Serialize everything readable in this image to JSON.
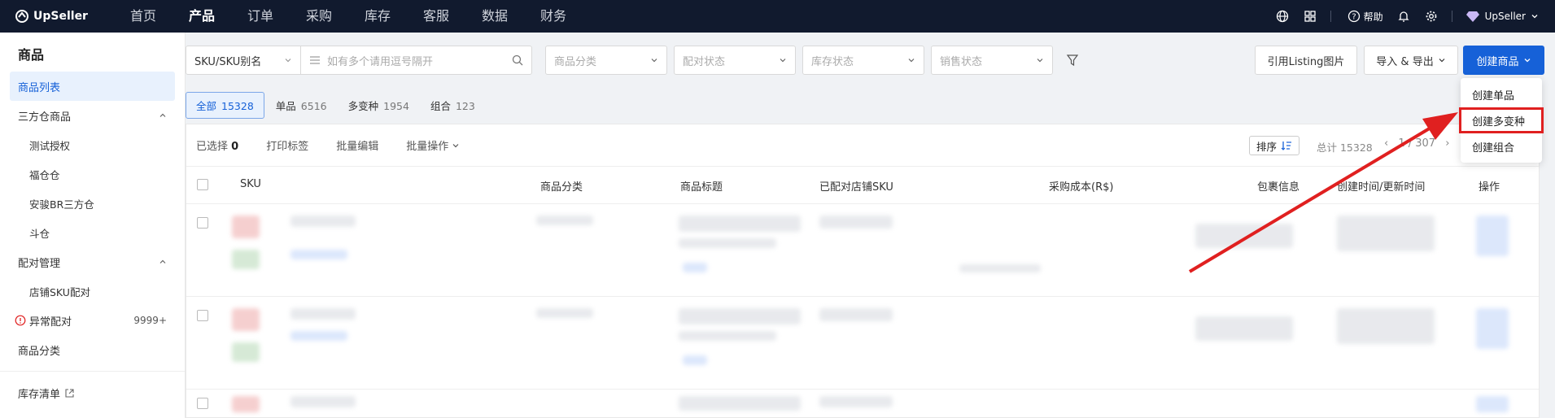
{
  "app": {
    "logo_text": "UpSeller"
  },
  "nav": {
    "items": [
      "首页",
      "产品",
      "订单",
      "采购",
      "库存",
      "客服",
      "数据",
      "财务"
    ],
    "active_index": 1,
    "help_label": "帮助",
    "user_label": "UpSeller"
  },
  "sidebar": {
    "title": "商品",
    "items": [
      {
        "label": "商品列表"
      },
      {
        "label": "三方仓商品"
      },
      {
        "label": "测试授权"
      },
      {
        "label": "福仓仓"
      },
      {
        "label": "安骏BR三方仓"
      },
      {
        "label": "斗仓"
      },
      {
        "label": "配对管理"
      },
      {
        "label": "店铺SKU配对"
      },
      {
        "label": "异常配对",
        "count": "9999+"
      },
      {
        "label": "商品分类"
      },
      {
        "label": "库存清单"
      }
    ]
  },
  "filters": {
    "sku_select": "SKU/SKU别名",
    "search_placeholder": "如有多个请用逗号隔开",
    "category": "商品分类",
    "pair_status": "配对状态",
    "stock_status": "库存状态",
    "sale_status": "销售状态",
    "listing_btn": "引用Listing图片",
    "import_btn": "导入 & 导出",
    "create_btn": "创建商品"
  },
  "status_tabs": [
    {
      "label": "全部",
      "count": "15328"
    },
    {
      "label": "单品",
      "count": "6516"
    },
    {
      "label": "多变种",
      "count": "1954"
    },
    {
      "label": "组合",
      "count": "123"
    }
  ],
  "toolbar": {
    "selected_label": "已选择",
    "selected_count": "0",
    "print": "打印标签",
    "batch_edit": "批量编辑",
    "batch_op": "批量操作",
    "sort": "排序",
    "total": "总计 15328",
    "pager": "1 / 307"
  },
  "table": {
    "headers": [
      "SKU",
      "商品分类",
      "商品标题",
      "已配对店铺SKU",
      "采购成本(R$)",
      "包裹信息",
      "创建时间/更新时间",
      "操作"
    ]
  },
  "dropdown": {
    "items": [
      "创建单品",
      "创建多变种",
      "创建组合"
    ],
    "highlighted_index": 1
  },
  "colors": {
    "nav_bg": "#111a2e",
    "primary": "#1661d8",
    "annotation_red": "#e02020"
  }
}
